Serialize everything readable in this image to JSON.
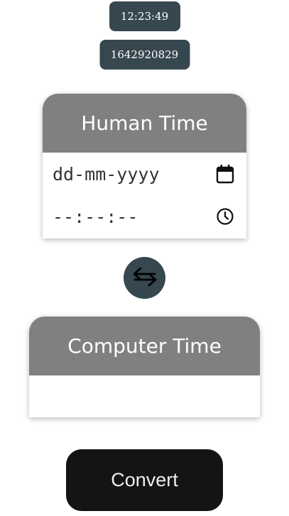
{
  "clock": {
    "time": "12:23:49",
    "epoch": "1642920829"
  },
  "human_card": {
    "title": "Human Time",
    "date_placeholder": "dd-mm-yyyy",
    "time_placeholder": "--:--:--",
    "date_icon": "calendar-icon",
    "time_icon": "clock-icon"
  },
  "swap": {
    "icon": "swap-arrows-icon"
  },
  "computer_card": {
    "title": "Computer Time",
    "value": ""
  },
  "actions": {
    "convert_label": "Convert"
  },
  "colors": {
    "pill_bg": "#37474f",
    "card_header_bg": "#808080",
    "convert_bg": "#141414"
  }
}
